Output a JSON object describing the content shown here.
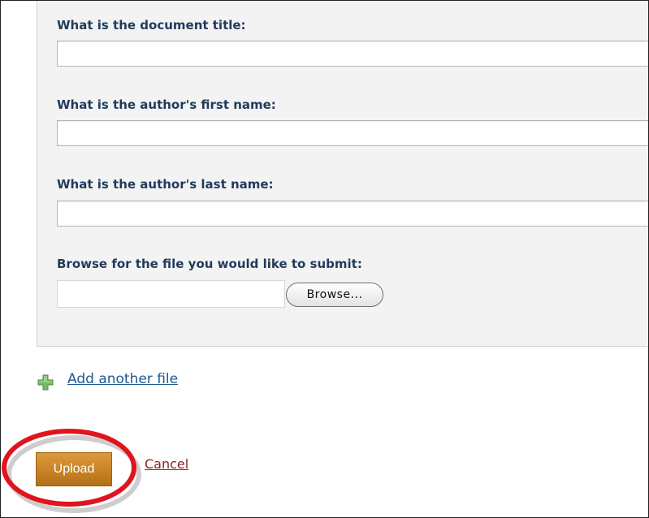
{
  "form": {
    "title_label": "What is the document title:",
    "title_value": "",
    "first_name_label": "What is the author's first name:",
    "first_name_value": "",
    "last_name_label": "What is the author's last name:",
    "last_name_value": "",
    "file_label": "Browse for the file you would like to submit:",
    "file_value": "",
    "browse_label": "Browse..."
  },
  "actions": {
    "add_file_label": "Add another file",
    "add_file_icon": "plus-icon",
    "upload_label": "Upload",
    "cancel_label": "Cancel"
  },
  "colors": {
    "label_text": "#1f3b5c",
    "link": "#1d5a93",
    "cancel_link": "#8e1f1f",
    "upload_button": "#c98426",
    "annotation_circle": "#e0141e",
    "plus_icon": "#7ab86a"
  }
}
